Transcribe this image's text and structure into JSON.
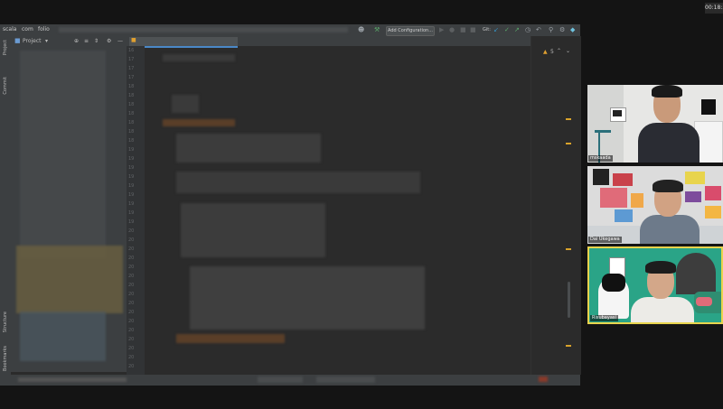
{
  "timer": "00:18:3",
  "ide": {
    "breadcrumbs": [
      "scala",
      "com",
      "folio"
    ],
    "toolbar": {
      "add_config_label": "Add Configuration...",
      "git_label": "Git:"
    },
    "project_panel": {
      "title": "Project"
    },
    "left_stripe": {
      "project": "Project",
      "commit": "Commit",
      "structure": "Structure",
      "bookmarks": "Bookmarks"
    },
    "inspections": {
      "warnings": "5"
    },
    "line_numbers": [
      "16",
      "17",
      "17",
      "17",
      "18",
      "18",
      "18",
      "18",
      "18",
      "18",
      "18",
      "19",
      "19",
      "19",
      "19",
      "19",
      "19",
      "19",
      "19",
      "19",
      "20",
      "20",
      "20",
      "20",
      "20",
      "20",
      "20",
      "20",
      "20",
      "20",
      "20",
      "20",
      "20",
      "20",
      "20",
      "20",
      "20"
    ]
  },
  "participants": [
    {
      "name": "mskaada",
      "accent": "#2b2b2b"
    },
    {
      "name": "Dai Ukegawa",
      "accent": "#2b2b2b"
    },
    {
      "name": "Risubayasi",
      "accent": "#e8d44d"
    }
  ]
}
